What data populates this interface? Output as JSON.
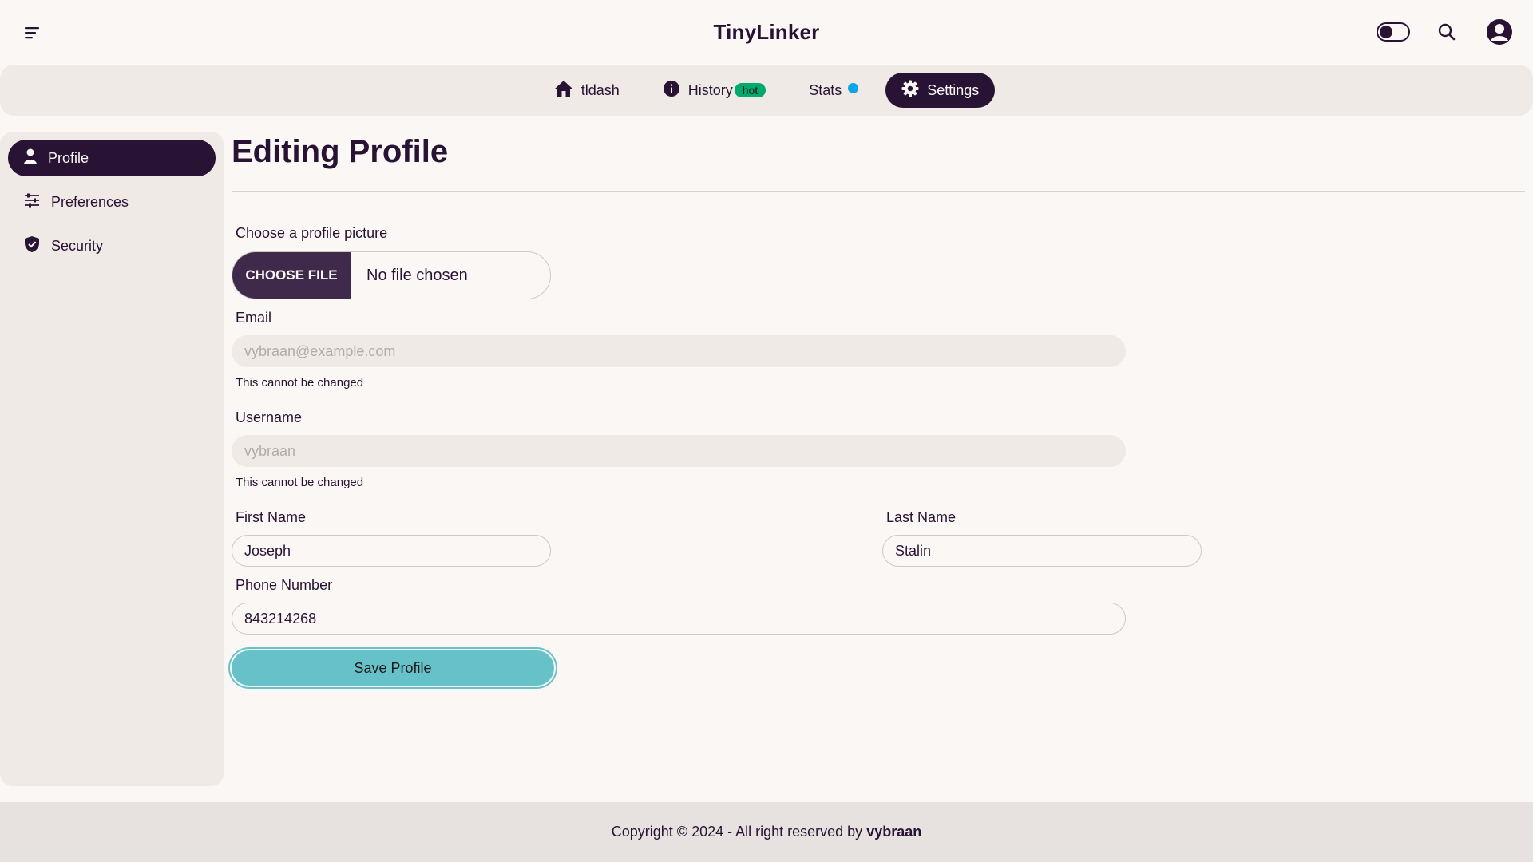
{
  "app": {
    "title": "TinyLinker"
  },
  "navbar": {
    "menu_icon": "menu-icon",
    "theme_toggle_icon": "theme-toggle",
    "search_icon": "search-icon",
    "profile_icon": "user-circle-icon"
  },
  "tabs": [
    {
      "label": "tldash",
      "icon": "home-icon",
      "active": false
    },
    {
      "label": "History",
      "icon": "info-icon",
      "badge": "hot",
      "active": false
    },
    {
      "label": "Stats",
      "icon": "blue-dot",
      "active": false
    },
    {
      "label": "Settings",
      "icon": "gear-icon",
      "active": true
    }
  ],
  "sidebar": {
    "items": [
      {
        "label": "Profile",
        "icon": "user-icon",
        "active": true
      },
      {
        "label": "Preferences",
        "icon": "sliders-icon",
        "active": false
      },
      {
        "label": "Security",
        "icon": "shield-icon",
        "active": false
      }
    ]
  },
  "main": {
    "title": "Editing Profile",
    "picture": {
      "label": "Choose a profile picture",
      "button": "CHOOSE FILE",
      "status": "No file chosen"
    },
    "email": {
      "label": "Email",
      "value": "vybraan@example.com",
      "hint": "This cannot be changed"
    },
    "username": {
      "label": "Username",
      "value": "vybraan",
      "hint": "This cannot be changed"
    },
    "first_name": {
      "label": "First Name",
      "value": "Joseph"
    },
    "last_name": {
      "label": "Last Name",
      "value": "Stalin"
    },
    "phone": {
      "label": "Phone Number",
      "value": "843214268"
    },
    "save_button": "Save Profile"
  },
  "footer": {
    "text": "Copyright © 2024 - All right reserved by",
    "author": "vybraan"
  },
  "colors": {
    "primary": "#291334",
    "accent_teal": "#66c2c8",
    "badge_green": "#00a96e",
    "dot_blue": "#0ea5e9",
    "background": "#faf7f5"
  }
}
